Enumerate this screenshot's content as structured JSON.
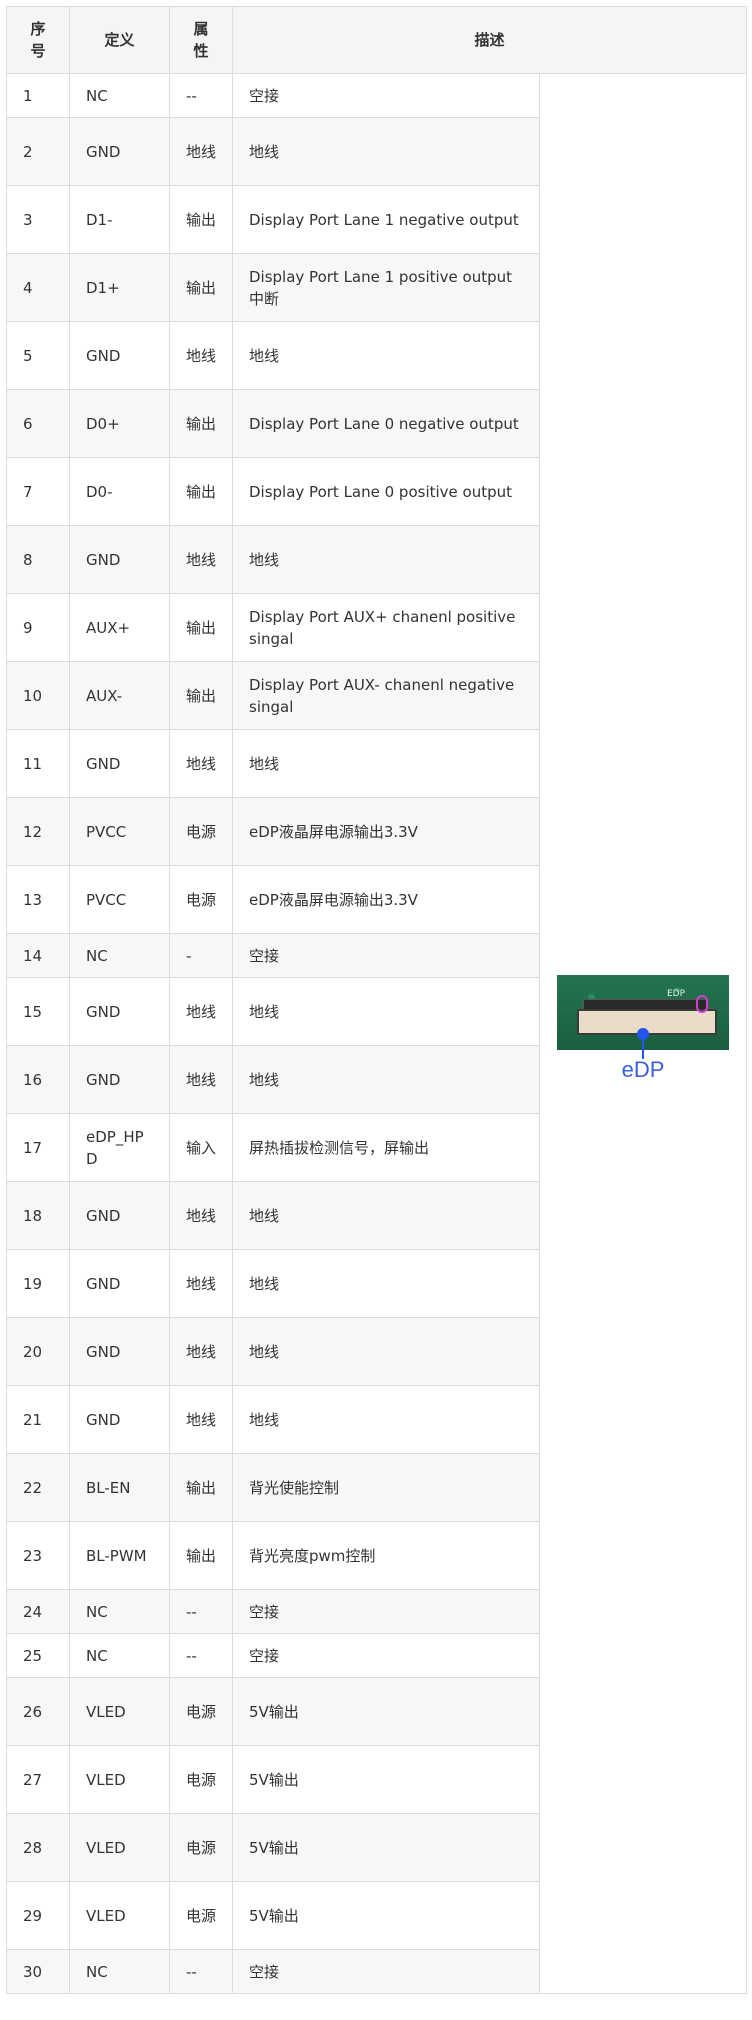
{
  "headers": {
    "no": "序号",
    "def": "定义",
    "attr": "属性",
    "desc": "描述"
  },
  "image_label": "eDP",
  "silk_text": "EDP",
  "rows": [
    {
      "no": "1",
      "def": "NC",
      "attr": "--",
      "desc": "空接"
    },
    {
      "no": "2",
      "def": "GND",
      "attr": "地线",
      "desc": "地线"
    },
    {
      "no": "3",
      "def": "D1-",
      "attr": "输出",
      "desc": "Display Port Lane 1 negative output"
    },
    {
      "no": "4",
      "def": "D1+",
      "attr": "输出",
      "desc": "Display Port Lane 1 positive output中断"
    },
    {
      "no": "5",
      "def": "GND",
      "attr": "地线",
      "desc": "地线"
    },
    {
      "no": "6",
      "def": "D0+",
      "attr": "输出",
      "desc": "Display Port Lane 0 negative output"
    },
    {
      "no": "7",
      "def": "D0-",
      "attr": "输出",
      "desc": "Display Port Lane 0 positive output"
    },
    {
      "no": "8",
      "def": "GND",
      "attr": "地线",
      "desc": "地线"
    },
    {
      "no": "9",
      "def": "AUX+",
      "attr": "输出",
      "desc": "Display Port AUX+ chanenl positive singal"
    },
    {
      "no": "10",
      "def": "AUX-",
      "attr": "输出",
      "desc": "Display Port AUX- chanenl negative singal"
    },
    {
      "no": "11",
      "def": "GND",
      "attr": "地线",
      "desc": "地线"
    },
    {
      "no": "12",
      "def": "PVCC",
      "attr": "电源",
      "desc": "eDP液晶屏电源输出3.3V"
    },
    {
      "no": "13",
      "def": "PVCC",
      "attr": "电源",
      "desc": "eDP液晶屏电源输出3.3V"
    },
    {
      "no": "14",
      "def": "NC",
      "attr": "-",
      "desc": "空接"
    },
    {
      "no": "15",
      "def": "GND",
      "attr": "地线",
      "desc": "地线"
    },
    {
      "no": "16",
      "def": "GND",
      "attr": "地线",
      "desc": "地线"
    },
    {
      "no": "17",
      "def": "eDP_HPD",
      "attr": "输入",
      "desc": "屏热插拔检测信号，屏输出"
    },
    {
      "no": "18",
      "def": "GND",
      "attr": "地线",
      "desc": "地线"
    },
    {
      "no": "19",
      "def": "GND",
      "attr": "地线",
      "desc": "地线"
    },
    {
      "no": "20",
      "def": "GND",
      "attr": "地线",
      "desc": "地线"
    },
    {
      "no": "21",
      "def": "GND",
      "attr": "地线",
      "desc": "地线"
    },
    {
      "no": "22",
      "def": "BL-EN",
      "attr": "输出",
      "desc": "背光使能控制"
    },
    {
      "no": "23",
      "def": "BL-PWM",
      "attr": "输出",
      "desc": "背光亮度pwm控制"
    },
    {
      "no": "24",
      "def": "NC",
      "attr": "--",
      "desc": "空接"
    },
    {
      "no": "25",
      "def": "NC",
      "attr": "--",
      "desc": "空接"
    },
    {
      "no": "26",
      "def": "VLED",
      "attr": "电源",
      "desc": "5V输出"
    },
    {
      "no": "27",
      "def": "VLED",
      "attr": "电源",
      "desc": "5V输出"
    },
    {
      "no": "28",
      "def": "VLED",
      "attr": "电源",
      "desc": "5V输出"
    },
    {
      "no": "29",
      "def": "VLED",
      "attr": "电源",
      "desc": "5V输出"
    },
    {
      "no": "30",
      "def": "NC",
      "attr": "--",
      "desc": "空接"
    }
  ]
}
